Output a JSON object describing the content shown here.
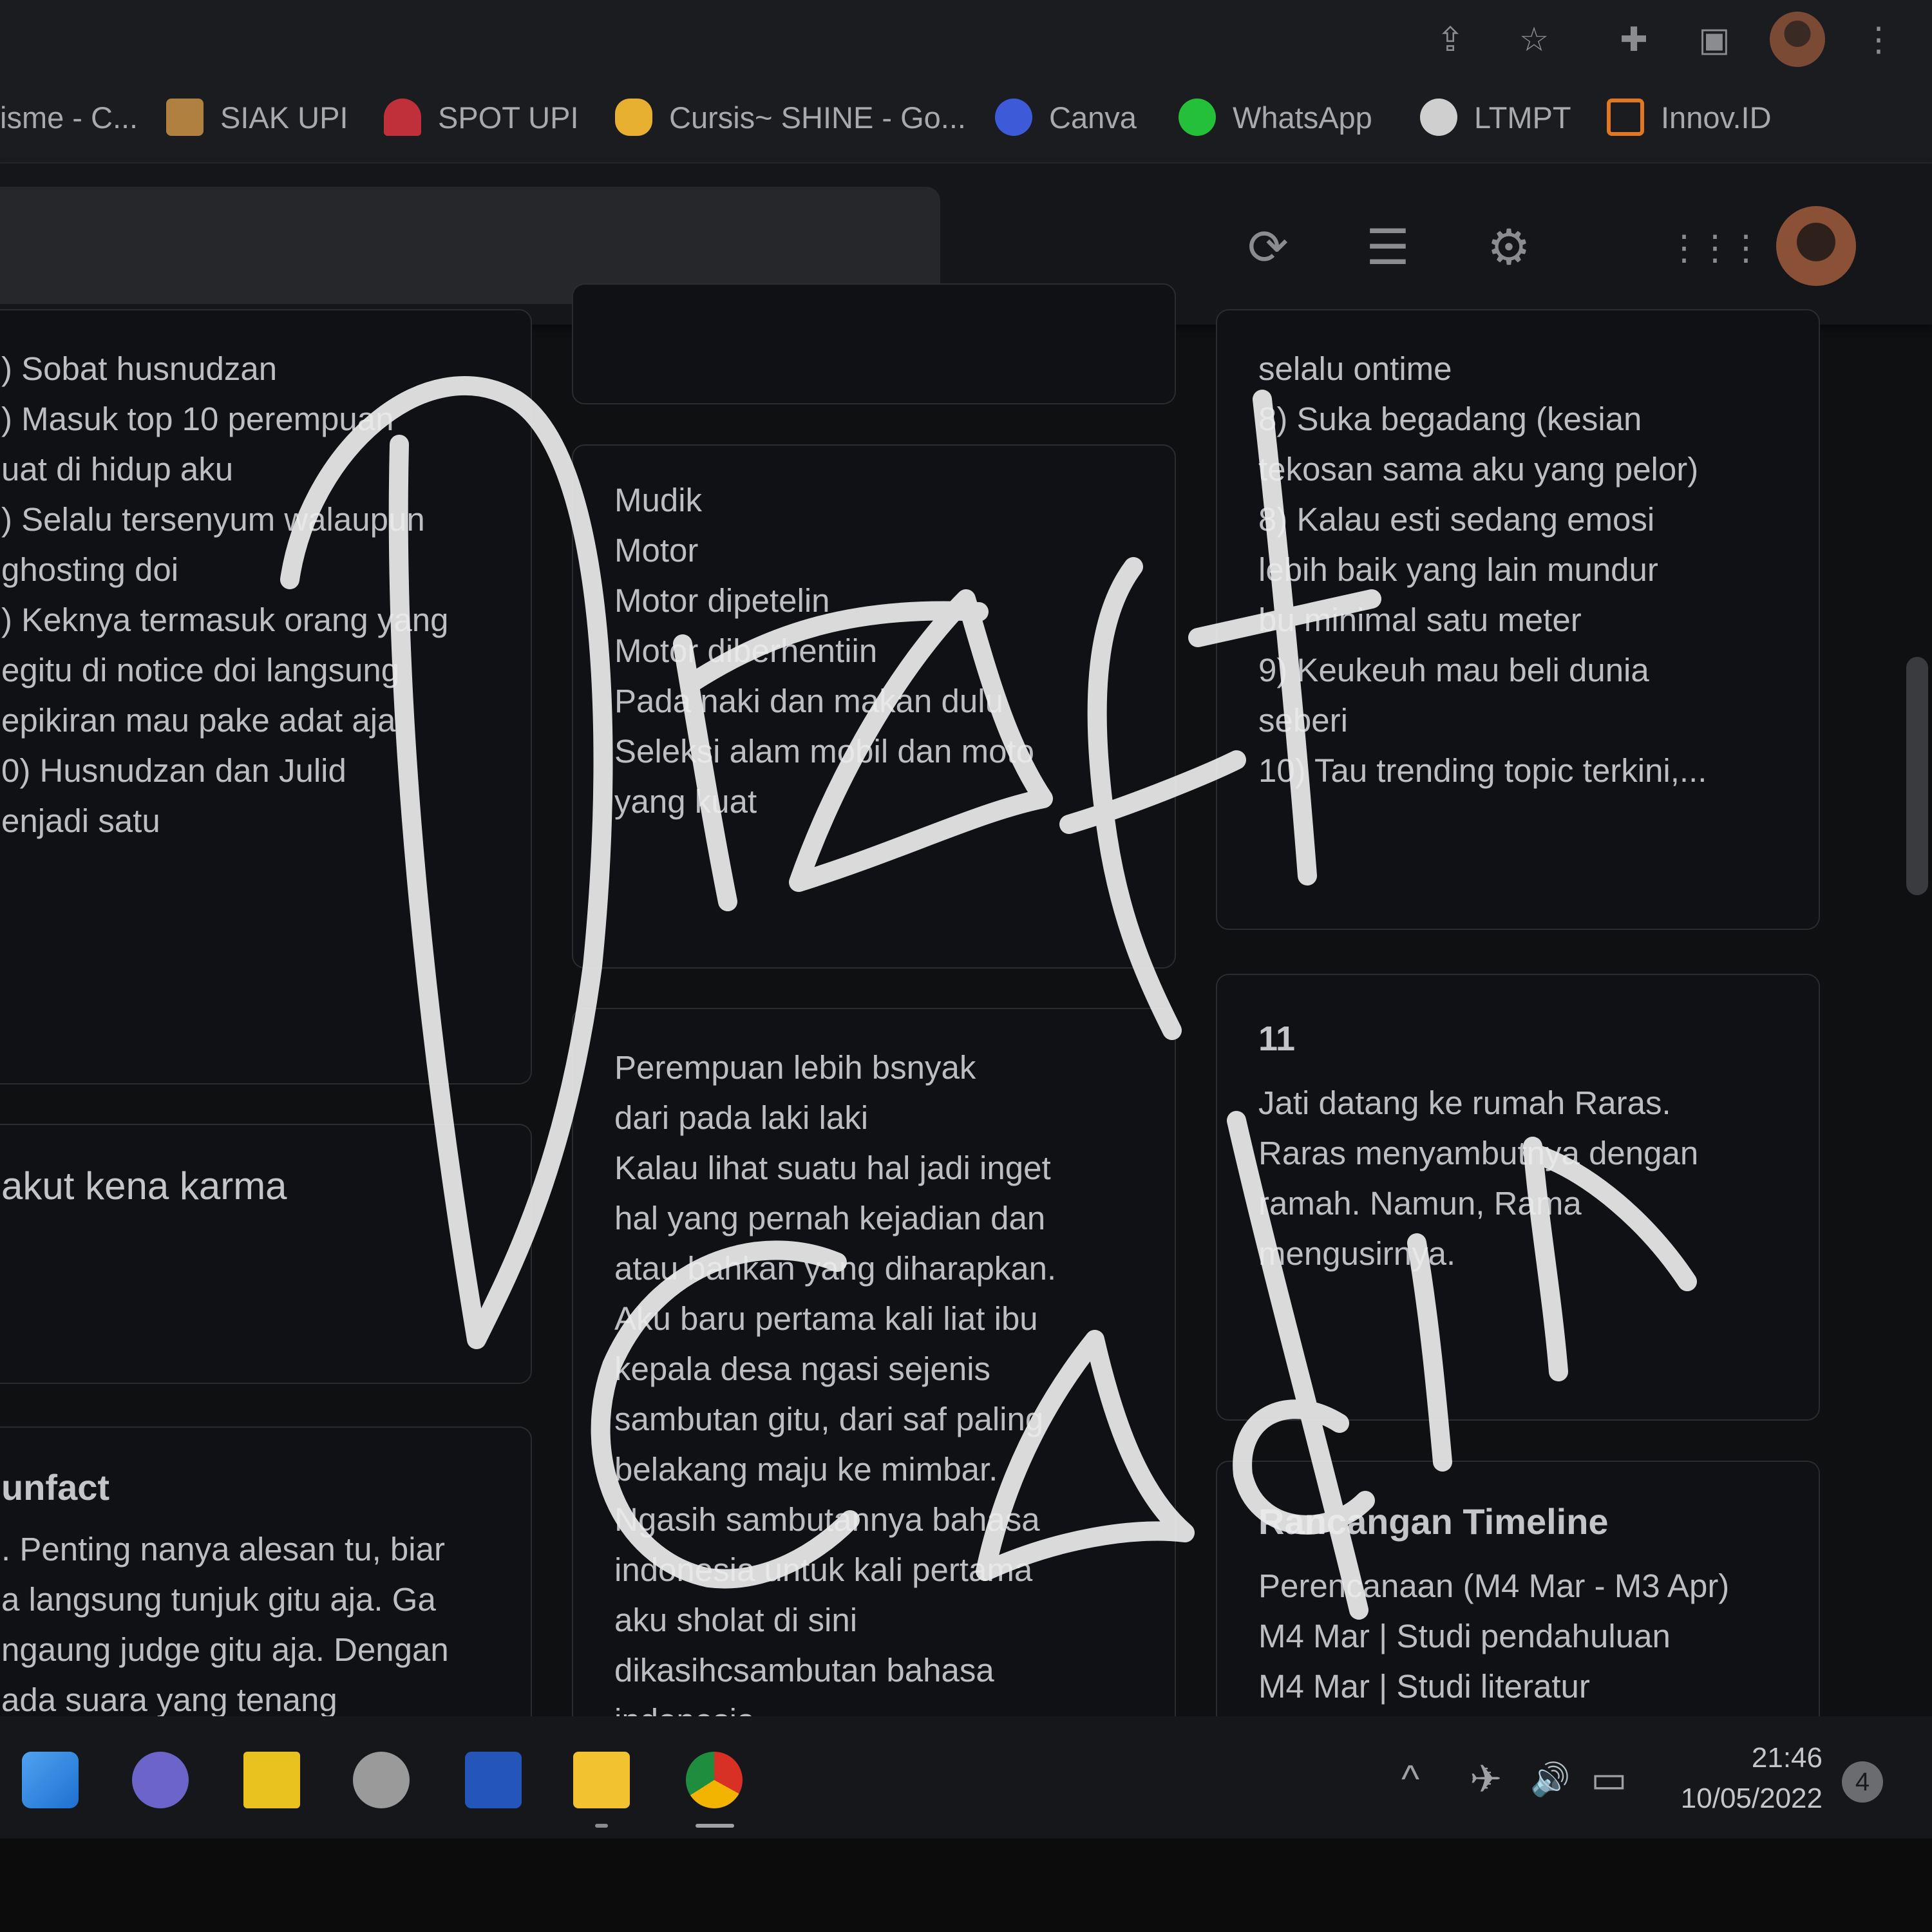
{
  "bookmarks": [
    {
      "label": "isme - C...",
      "icon": "bookmark-favicon",
      "color": "#888888"
    },
    {
      "label": "SIAK UPI",
      "icon": "siak-upi-favicon",
      "color": "#b08040"
    },
    {
      "label": "SPOT UPI",
      "icon": "spot-upi-favicon",
      "color": "#c0303a"
    },
    {
      "label": "Cursis~ SHINE - Go...",
      "icon": "cursis-favicon",
      "color": "#e8b030"
    },
    {
      "label": "Canva",
      "icon": "canva-favicon",
      "color": "#3d5bd9"
    },
    {
      "label": "WhatsApp",
      "icon": "whatsapp-favicon",
      "color": "#25c03a"
    },
    {
      "label": "LTMPT",
      "icon": "globe-favicon",
      "color": "#cfcfcf"
    },
    {
      "label": "Innov.ID",
      "icon": "innovid-favicon",
      "color": "#e07820"
    }
  ],
  "toolbar": {
    "refresh_icon": "⟳",
    "list_view_icon": "☰",
    "settings_icon": "⚙",
    "apps_icon": "⋮⋮⋮"
  },
  "chrome": {
    "share_icon": "⇪",
    "star_icon": "☆",
    "extensions_icon": "✚",
    "sidepanel_icon": "▣",
    "menu_icon": "⋮"
  },
  "notes": {
    "left_card_1": {
      "lines": [
        ") Sobat husnudzan",
        ") Masuk top 10 perempuan",
        "uat di hidup aku",
        ") Selalu tersenyum walaupun",
        " ghosting doi",
        ") Keknya termasuk orang yang",
        "egitu di notice doi langsung",
        "epikiran mau pake adat aja",
        "0) Husnudzan dan Julid",
        "enjadi satu"
      ]
    },
    "left_card_2": {
      "title": "akut kena karma"
    },
    "left_card_3": {
      "title": "unfact",
      "lines": [
        ". Penting nanya alesan tu, biar",
        "a langsung tunjuk gitu aja. Ga",
        "ngaung judge gitu aja. Dengan",
        "ada suara yang tenang"
      ]
    },
    "mid_card_2": {
      "lines": [
        "Mudik",
        "Motor",
        "Motor dipetelin",
        "Motor diberhentiin",
        "Pada naki dan makan dulu",
        "Seleksi alam mobil dan moto",
        "yang kuat"
      ]
    },
    "mid_card_3": {
      "lines": [
        "Perempuan lebih bsnyak",
        "dari pada laki laki",
        "Kalau lihat suatu hal jadi inget",
        "hal yang pernah kejadian dan",
        "atau bahkan yang diharapkan.",
        "Aku baru pertama kali liat ibu",
        "kepala desa ngasi sejenis",
        "sambutan gitu, dari saf paling",
        "belakang maju ke mimbar.",
        "Ngasih sambutannya bahasa",
        "indonesia untuk kali pertama",
        "aku sholat di sini",
        "dikasihcsambutan bahasa",
        "indonesia"
      ]
    },
    "right_card_1": {
      "lines": [
        "selalu ontime",
        "8) Suka begadang (kesian",
        "tekosan sama aku yang pelor)",
        "8) Kalau esti sedang emosi",
        "lebih baik yang lain mundur",
        "bu minimal satu meter",
        "9) Keukeuh mau beli dunia",
        "seberi",
        "10) Tau trending topic terkini,..."
      ]
    },
    "right_card_2": {
      "title": "11",
      "lines": [
        "Jati datang ke rumah Raras.",
        "Raras menyambutnya dengan",
        "ramah. Namun, Rama",
        "mengusirnya."
      ]
    },
    "right_card_3": {
      "title": "Rancangan Timeline",
      "lines": [
        "Perencanaan (M4 Mar - M3 Apr)",
        "M4 Mar | Studi pendahuluan",
        "M4 Mar | Studi literatur"
      ]
    }
  },
  "overlay": {
    "word1": "Draft",
    "word2": "Cadin",
    "stroke_color": "#ececec"
  },
  "taskbar": {
    "apps": [
      "windows-start-icon",
      "teams-icon",
      "sticky-notes-icon",
      "clock-icon",
      "word-icon",
      "file-explorer-icon",
      "chrome-icon"
    ],
    "tray_up": "^",
    "tray_airplane": "✈",
    "tray_volume": "🔊",
    "tray_battery": "▭",
    "time": "21:46",
    "date": "10/05/2022",
    "notification_count": "4"
  }
}
